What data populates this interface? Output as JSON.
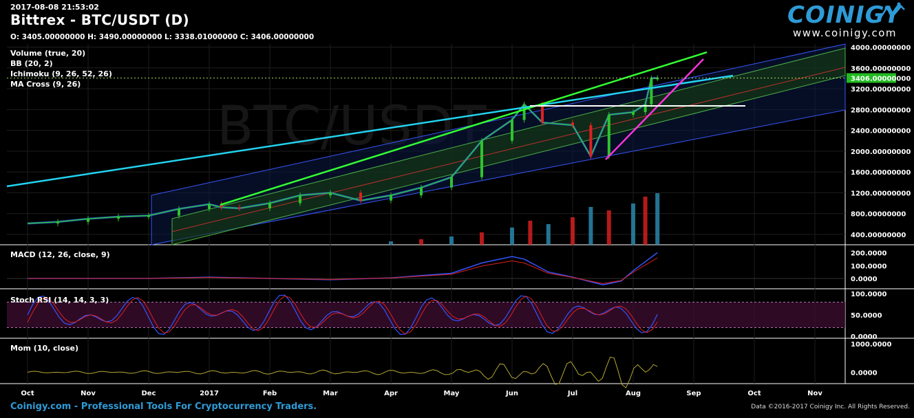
{
  "header": {
    "timestamp": "2017-08-08 21:53:02",
    "title": "Bittrex - BTC/USDT (D)",
    "ohlc": "O: 3405.00000000 H: 3490.00000000 L: 3338.01000000 C: 3406.00000000"
  },
  "logo": {
    "brand": "COINIGY",
    "url": "www.coinigy.com"
  },
  "indicators": [
    {
      "label": "Volume (true, 20)"
    },
    {
      "label": "BB (20, 2)"
    },
    {
      "label": "Ichimoku (9, 26, 52, 26)"
    },
    {
      "label": "MA Cross (9, 26)"
    }
  ],
  "panels": {
    "macd": "MACD (12, 26, close, 9)",
    "stoch": "Stoch RSI (14, 14, 3, 3)",
    "mom": "Mom (10, close)"
  },
  "watermark": "BTC/USDT",
  "footer": {
    "left": "Coinigy.com - Professional Tools For Cryptocurrency Traders.",
    "right": "Data ©2016-2017 Coinigy Inc. All Rights Reserved."
  },
  "colors": {
    "candle_up": "#2ec42e",
    "candle_down": "#e02020",
    "trend_cyan": "#22d3f0",
    "trend_green": "#33ff33",
    "trend_magenta": "#ff33dd",
    "price_badge": "#22bb22"
  },
  "chart_data": {
    "type": "candlestick",
    "symbol": "BTC/USDT",
    "exchange": "Bittrex",
    "interval": "D",
    "last_price_label": "3406.00000000",
    "x_ticks": [
      "Oct",
      "Nov",
      "Dec",
      "2017",
      "Feb",
      "Mar",
      "Apr",
      "May",
      "Jun",
      "Jul",
      "Aug",
      "Sep",
      "Oct",
      "Nov"
    ],
    "price_axis": {
      "ticks": [
        "400.00000000",
        "800.00000000",
        "1200.00000000",
        "1600.00000000",
        "2000.00000000",
        "2400.00000000",
        "2800.00000000",
        "3200.00000000",
        "3600.00000000",
        "4000.00000000"
      ],
      "range": [
        200,
        4060
      ]
    },
    "price_series": {
      "x_month_index": [
        0,
        0.5,
        1,
        1.5,
        2,
        2.5,
        3,
        3.2,
        3.5,
        4,
        4.5,
        5,
        5.5,
        6,
        6.5,
        7,
        7.5,
        8,
        8.2,
        8.5,
        9,
        9.3,
        9.6,
        10,
        10.2,
        10.3,
        10.4
      ],
      "close": [
        610,
        640,
        700,
        740,
        760,
        890,
        980,
        920,
        900,
        1000,
        1150,
        1200,
        1050,
        1150,
        1300,
        1500,
        2200,
        2600,
        2900,
        2550,
        2500,
        1900,
        2700,
        2750,
        2900,
        3400,
        3406
      ]
    },
    "volume_series": {
      "x_month_index": [
        6,
        6.5,
        7,
        7.5,
        8,
        8.3,
        8.6,
        9,
        9.3,
        9.6,
        10,
        10.2,
        10.4
      ],
      "values": [
        5,
        8,
        12,
        18,
        25,
        35,
        30,
        40,
        55,
        50,
        60,
        70,
        75
      ]
    },
    "macd": {
      "ticks": [
        "0.0000",
        "100.0000",
        "200.0000"
      ],
      "range": [
        -80,
        240
      ],
      "x_month_index": [
        0,
        2,
        3,
        4,
        5,
        6,
        7,
        7.5,
        8,
        8.2,
        8.6,
        9,
        9.5,
        9.8,
        10,
        10.4
      ],
      "values": [
        0,
        0,
        10,
        0,
        -10,
        5,
        40,
        120,
        170,
        150,
        50,
        10,
        -50,
        -20,
        60,
        200
      ]
    },
    "stoch_rsi": {
      "ticks": [
        "0.0000",
        "50.0000",
        "100.0000"
      ],
      "range": [
        0,
        100
      ],
      "levels": [
        80,
        20
      ]
    },
    "momentum": {
      "ticks": [
        "0.0000",
        "1000.0000"
      ],
      "range": [
        -400,
        1100
      ]
    }
  }
}
